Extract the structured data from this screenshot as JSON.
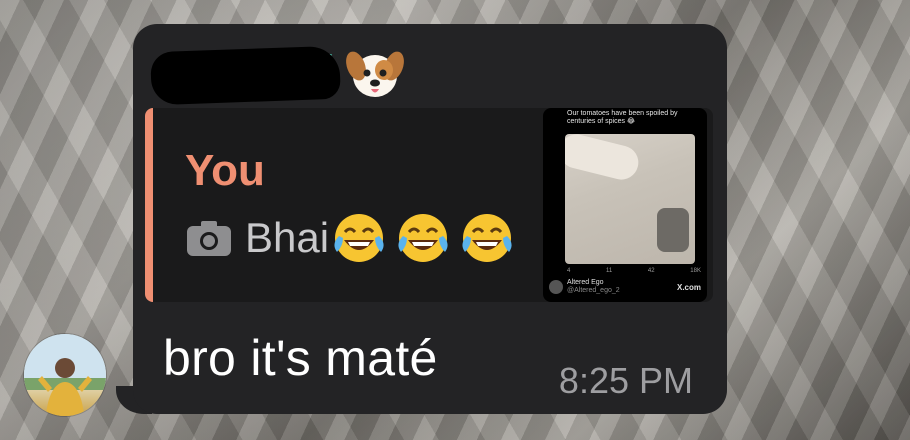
{
  "sender": {
    "name": "███████",
    "emoji": "dog-face-icon"
  },
  "reply": {
    "author": "You",
    "media_icon": "camera-icon",
    "text": "Bhai",
    "emojis": [
      "face-with-tears-of-joy-icon",
      "face-with-tears-of-joy-icon",
      "face-with-tears-of-joy-icon"
    ],
    "thumbnail": {
      "caption": "Our tomatoes have been spoiled by centuries of spices 😂",
      "stats": [
        "4",
        "11",
        "42",
        "18K"
      ],
      "account_name": "Altered Ego",
      "account_handle": "@Altered_ego_2",
      "domain": "X.com"
    }
  },
  "message": {
    "text": "bro it's maté",
    "time": "8:25 PM"
  },
  "colors": {
    "bubble": "#232325",
    "reply_accent": "#ef8f72",
    "reply_text": "#c9c9cb",
    "timestamp": "#9e9ea1",
    "sender_name": "#4fc9b3"
  }
}
